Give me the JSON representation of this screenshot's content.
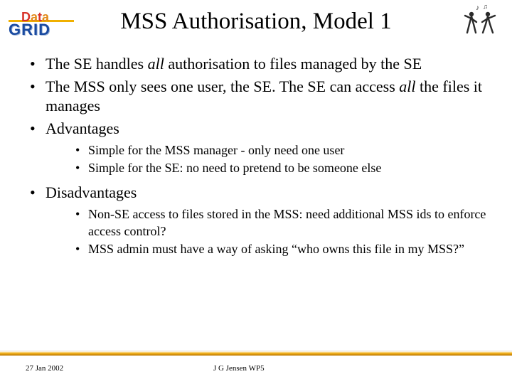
{
  "logo_left": {
    "top": "Data",
    "bottom": "GRID"
  },
  "title": "MSS Authorisation, Model 1",
  "bullets": [
    {
      "parts": [
        {
          "t": "The SE handles ",
          "i": false
        },
        {
          "t": "all",
          "i": true
        },
        {
          "t": " authorisation to files managed by the SE",
          "i": false
        }
      ]
    },
    {
      "parts": [
        {
          "t": "The MSS only sees one user, the SE.  The SE can access ",
          "i": false
        },
        {
          "t": "all",
          "i": true
        },
        {
          "t": " the files it manages",
          "i": false
        }
      ]
    },
    {
      "parts": [
        {
          "t": "Advantages",
          "i": false
        }
      ],
      "sub": [
        "Simple for the MSS manager - only need one user",
        "Simple for the SE: no need to pretend to be someone else"
      ]
    },
    {
      "parts": [
        {
          "t": "Disadvantages",
          "i": false
        }
      ],
      "sub": [
        "Non-SE access to files stored in the MSS: need additional MSS ids to enforce access control?",
        "MSS admin must have a way of asking “who owns this file in my MSS?”"
      ]
    }
  ],
  "footer": {
    "date": "27 Jan 2002",
    "author": "J G Jensen WP5"
  }
}
